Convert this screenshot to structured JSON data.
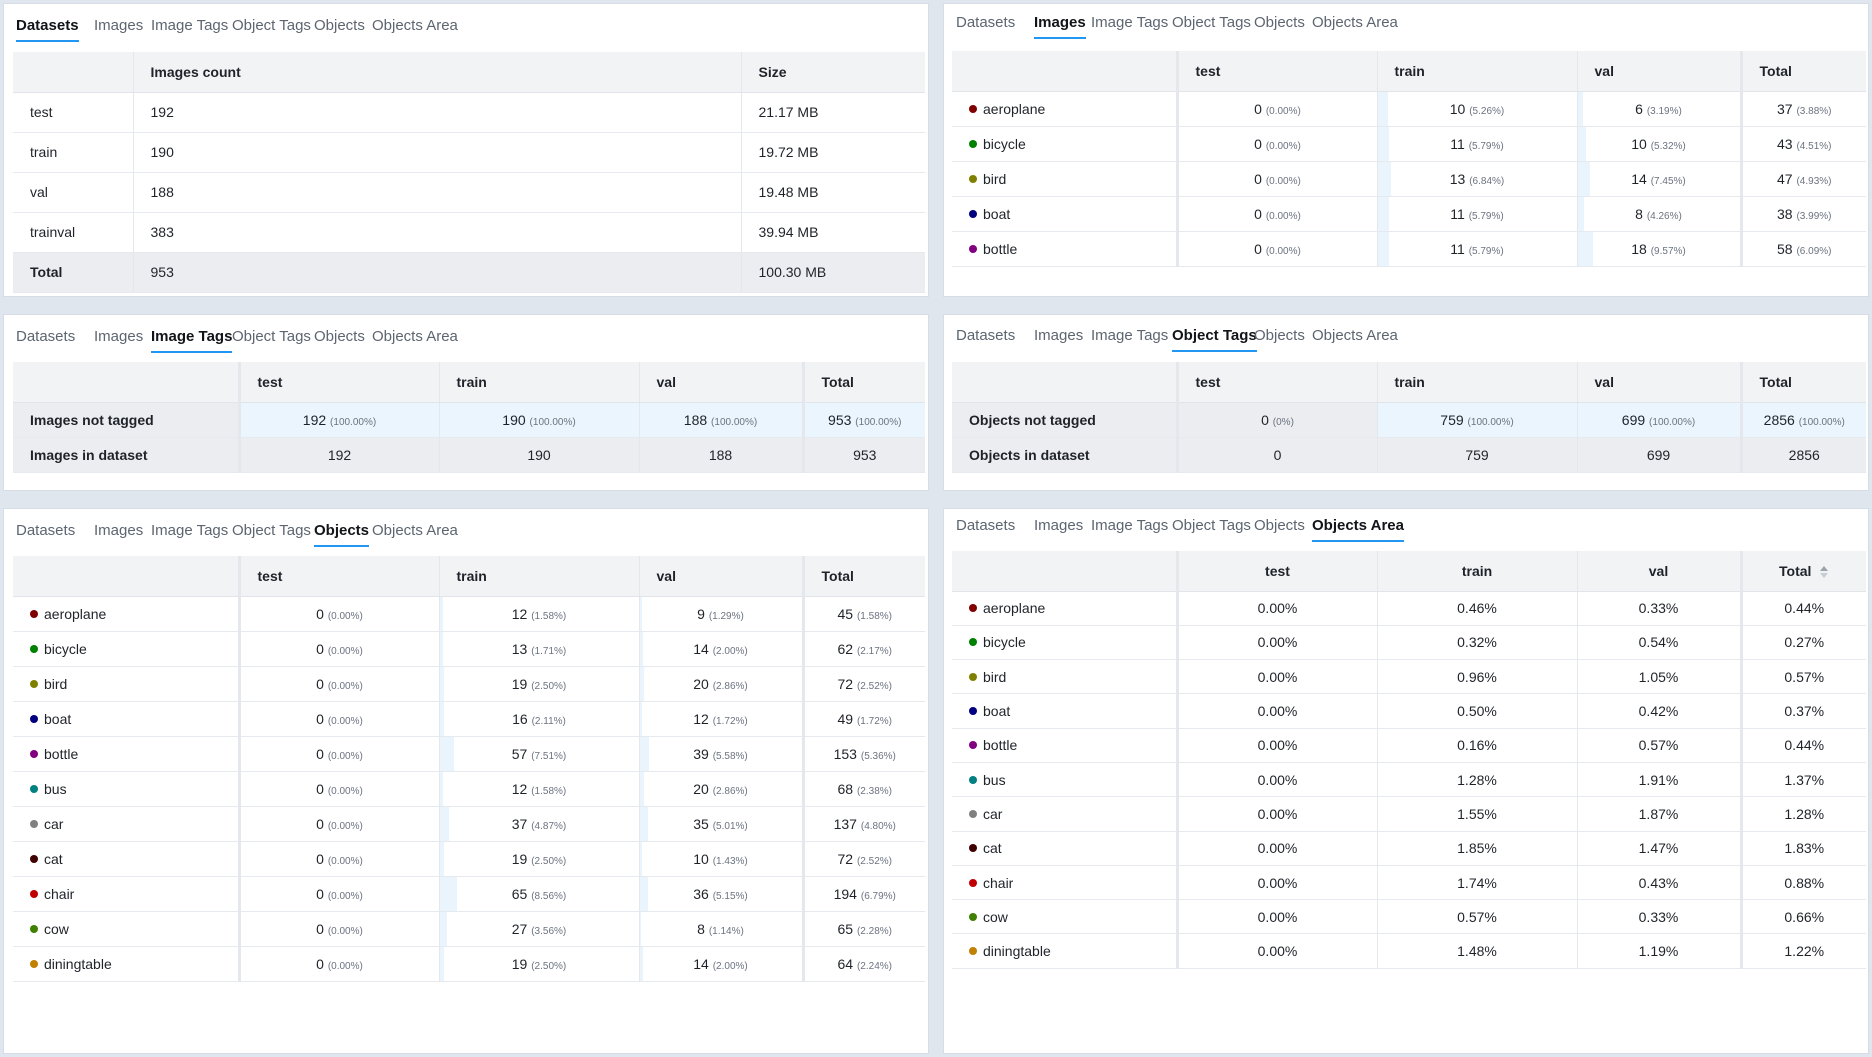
{
  "tabs": [
    "Datasets",
    "Images",
    "Image Tags",
    "Object Tags",
    "Objects",
    "Objects Area"
  ],
  "colors": {
    "accent": "#2196f3",
    "aeroplane": "#800000",
    "bicycle": "#008000",
    "bird": "#808000",
    "boat": "#000080",
    "bottle": "#800080",
    "bus": "#008080",
    "car": "#808080",
    "cat": "#400000",
    "chair": "#c00000",
    "cow": "#408000",
    "diningtable": "#c08000"
  },
  "datasets": {
    "active_tab": "Datasets",
    "headers": [
      "",
      "Images count",
      "Size"
    ],
    "rows": [
      {
        "name": "test",
        "count": "192",
        "size": "21.17 MB"
      },
      {
        "name": "train",
        "count": "190",
        "size": "19.72 MB"
      },
      {
        "name": "val",
        "count": "188",
        "size": "19.48 MB"
      },
      {
        "name": "trainval",
        "count": "383",
        "size": "39.94 MB"
      }
    ],
    "total": {
      "name": "Total",
      "count": "953",
      "size": "100.30 MB"
    }
  },
  "images": {
    "active_tab": "Images",
    "headers": [
      "",
      "test",
      "train",
      "val",
      "Total"
    ],
    "rows": [
      {
        "name": "aeroplane",
        "color": "#800000",
        "cells": [
          [
            "0",
            "(0.00%)"
          ],
          [
            "10",
            "(5.26%)"
          ],
          [
            "6",
            "(3.19%)"
          ],
          [
            "37",
            "(3.88%)"
          ]
        ]
      },
      {
        "name": "bicycle",
        "color": "#008000",
        "cells": [
          [
            "0",
            "(0.00%)"
          ],
          [
            "11",
            "(5.79%)"
          ],
          [
            "10",
            "(5.32%)"
          ],
          [
            "43",
            "(4.51%)"
          ]
        ]
      },
      {
        "name": "bird",
        "color": "#808000",
        "cells": [
          [
            "0",
            "(0.00%)"
          ],
          [
            "13",
            "(6.84%)"
          ],
          [
            "14",
            "(7.45%)"
          ],
          [
            "47",
            "(4.93%)"
          ]
        ]
      },
      {
        "name": "boat",
        "color": "#000080",
        "cells": [
          [
            "0",
            "(0.00%)"
          ],
          [
            "11",
            "(5.79%)"
          ],
          [
            "8",
            "(4.26%)"
          ],
          [
            "38",
            "(3.99%)"
          ]
        ]
      },
      {
        "name": "bottle",
        "color": "#800080",
        "cells": [
          [
            "0",
            "(0.00%)"
          ],
          [
            "11",
            "(5.79%)"
          ],
          [
            "18",
            "(9.57%)"
          ],
          [
            "58",
            "(6.09%)"
          ]
        ]
      }
    ]
  },
  "image_tags": {
    "active_tab": "Image Tags",
    "headers": [
      "",
      "test",
      "train",
      "val",
      "Total"
    ],
    "rows": [
      {
        "name": "Images not tagged",
        "cells": [
          [
            "192",
            "(100.00%)"
          ],
          [
            "190",
            "(100.00%)"
          ],
          [
            "188",
            "(100.00%)"
          ],
          [
            "953",
            "(100.00%)"
          ]
        ]
      },
      {
        "name": "Images in dataset",
        "cells": [
          [
            "192",
            ""
          ],
          [
            "190",
            ""
          ],
          [
            "188",
            ""
          ],
          [
            "953",
            ""
          ]
        ]
      }
    ]
  },
  "object_tags": {
    "active_tab": "Object Tags",
    "headers": [
      "",
      "test",
      "train",
      "val",
      "Total"
    ],
    "rows": [
      {
        "name": "Objects not tagged",
        "cells": [
          [
            "0",
            "(0%)"
          ],
          [
            "759",
            "(100.00%)"
          ],
          [
            "699",
            "(100.00%)"
          ],
          [
            "2856",
            "(100.00%)"
          ]
        ]
      },
      {
        "name": "Objects in dataset",
        "cells": [
          [
            "0",
            ""
          ],
          [
            "759",
            ""
          ],
          [
            "699",
            ""
          ],
          [
            "2856",
            ""
          ]
        ]
      }
    ]
  },
  "objects": {
    "active_tab": "Objects",
    "headers": [
      "",
      "test",
      "train",
      "val",
      "Total"
    ],
    "rows": [
      {
        "name": "aeroplane",
        "color": "#800000",
        "cells": [
          [
            "0",
            "(0.00%)"
          ],
          [
            "12",
            "(1.58%)"
          ],
          [
            "9",
            "(1.29%)"
          ],
          [
            "45",
            "(1.58%)"
          ]
        ]
      },
      {
        "name": "bicycle",
        "color": "#008000",
        "cells": [
          [
            "0",
            "(0.00%)"
          ],
          [
            "13",
            "(1.71%)"
          ],
          [
            "14",
            "(2.00%)"
          ],
          [
            "62",
            "(2.17%)"
          ]
        ]
      },
      {
        "name": "bird",
        "color": "#808000",
        "cells": [
          [
            "0",
            "(0.00%)"
          ],
          [
            "19",
            "(2.50%)"
          ],
          [
            "20",
            "(2.86%)"
          ],
          [
            "72",
            "(2.52%)"
          ]
        ]
      },
      {
        "name": "boat",
        "color": "#000080",
        "cells": [
          [
            "0",
            "(0.00%)"
          ],
          [
            "16",
            "(2.11%)"
          ],
          [
            "12",
            "(1.72%)"
          ],
          [
            "49",
            "(1.72%)"
          ]
        ]
      },
      {
        "name": "bottle",
        "color": "#800080",
        "cells": [
          [
            "0",
            "(0.00%)"
          ],
          [
            "57",
            "(7.51%)"
          ],
          [
            "39",
            "(5.58%)"
          ],
          [
            "153",
            "(5.36%)"
          ]
        ]
      },
      {
        "name": "bus",
        "color": "#008080",
        "cells": [
          [
            "0",
            "(0.00%)"
          ],
          [
            "12",
            "(1.58%)"
          ],
          [
            "20",
            "(2.86%)"
          ],
          [
            "68",
            "(2.38%)"
          ]
        ]
      },
      {
        "name": "car",
        "color": "#808080",
        "cells": [
          [
            "0",
            "(0.00%)"
          ],
          [
            "37",
            "(4.87%)"
          ],
          [
            "35",
            "(5.01%)"
          ],
          [
            "137",
            "(4.80%)"
          ]
        ]
      },
      {
        "name": "cat",
        "color": "#400000",
        "cells": [
          [
            "0",
            "(0.00%)"
          ],
          [
            "19",
            "(2.50%)"
          ],
          [
            "10",
            "(1.43%)"
          ],
          [
            "72",
            "(2.52%)"
          ]
        ]
      },
      {
        "name": "chair",
        "color": "#c00000",
        "cells": [
          [
            "0",
            "(0.00%)"
          ],
          [
            "65",
            "(8.56%)"
          ],
          [
            "36",
            "(5.15%)"
          ],
          [
            "194",
            "(6.79%)"
          ]
        ]
      },
      {
        "name": "cow",
        "color": "#408000",
        "cells": [
          [
            "0",
            "(0.00%)"
          ],
          [
            "27",
            "(3.56%)"
          ],
          [
            "8",
            "(1.14%)"
          ],
          [
            "65",
            "(2.28%)"
          ]
        ]
      },
      {
        "name": "diningtable",
        "color": "#c08000",
        "cells": [
          [
            "0",
            "(0.00%)"
          ],
          [
            "19",
            "(2.50%)"
          ],
          [
            "14",
            "(2.00%)"
          ],
          [
            "64",
            "(2.24%)"
          ]
        ]
      }
    ]
  },
  "objects_area": {
    "active_tab": "Objects Area",
    "headers": [
      "",
      "test",
      "train",
      "val",
      "Total"
    ],
    "rows": [
      {
        "name": "aeroplane",
        "color": "#800000",
        "cells": [
          "0.00%",
          "0.46%",
          "0.33%",
          "0.44%"
        ]
      },
      {
        "name": "bicycle",
        "color": "#008000",
        "cells": [
          "0.00%",
          "0.32%",
          "0.54%",
          "0.27%"
        ]
      },
      {
        "name": "bird",
        "color": "#808000",
        "cells": [
          "0.00%",
          "0.96%",
          "1.05%",
          "0.57%"
        ]
      },
      {
        "name": "boat",
        "color": "#000080",
        "cells": [
          "0.00%",
          "0.50%",
          "0.42%",
          "0.37%"
        ]
      },
      {
        "name": "bottle",
        "color": "#800080",
        "cells": [
          "0.00%",
          "0.16%",
          "0.57%",
          "0.44%"
        ]
      },
      {
        "name": "bus",
        "color": "#008080",
        "cells": [
          "0.00%",
          "1.28%",
          "1.91%",
          "1.37%"
        ]
      },
      {
        "name": "car",
        "color": "#808080",
        "cells": [
          "0.00%",
          "1.55%",
          "1.87%",
          "1.28%"
        ]
      },
      {
        "name": "cat",
        "color": "#400000",
        "cells": [
          "0.00%",
          "1.85%",
          "1.47%",
          "1.83%"
        ]
      },
      {
        "name": "chair",
        "color": "#c00000",
        "cells": [
          "0.00%",
          "1.74%",
          "0.43%",
          "0.88%"
        ]
      },
      {
        "name": "cow",
        "color": "#408000",
        "cells": [
          "0.00%",
          "0.57%",
          "0.33%",
          "0.66%"
        ]
      },
      {
        "name": "diningtable",
        "color": "#c08000",
        "cells": [
          "0.00%",
          "1.48%",
          "1.19%",
          "1.22%"
        ]
      }
    ]
  }
}
